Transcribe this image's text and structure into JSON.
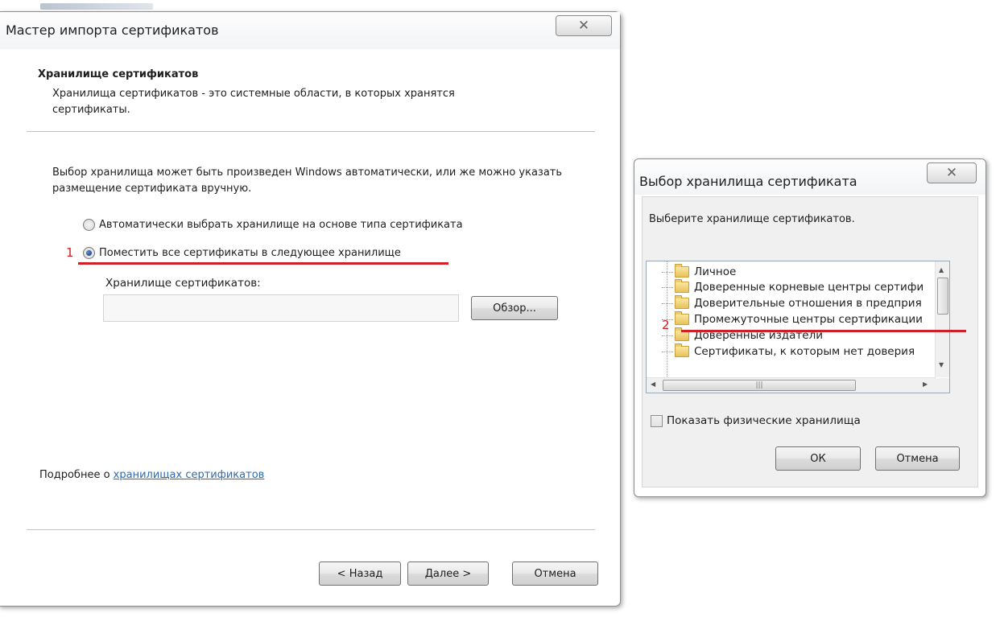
{
  "wizard": {
    "title": "Мастер импорта сертификатов",
    "section_title": "Хранилище сертификатов",
    "section_desc": "Хранилища сертификатов - это системные области, в которых хранятся сертификаты.",
    "intro": "Выбор хранилища может быть произведен Windows автоматически, или же можно указать размещение сертификата вручную.",
    "radio_auto": "Автоматически выбрать хранилище на основе типа сертификата",
    "radio_manual": "Поместить все сертификаты в следующее хранилище",
    "marker_1": "1",
    "store_label": "Хранилище сертификатов:",
    "store_value": "",
    "browse_label": "Обзор...",
    "more_prefix": "Подробнее о",
    "more_link": "хранилищах сертификатов",
    "back_label": "< Назад",
    "next_label": "Далее >",
    "cancel_label": "Отмена"
  },
  "store_dialog": {
    "title": "Выбор хранилища сертификата",
    "prompt": "Выберите хранилище сертификатов.",
    "items": [
      "Личное",
      "Доверенные корневые центры сертифи",
      "Доверительные отношения в предприя",
      "Промежуточные центры сертификации",
      "Доверенные издатели",
      "Сертификаты, к которым нет доверия"
    ],
    "marker_2": "2",
    "show_physical": "Показать физические хранилища",
    "ok_label": "ОК",
    "cancel_label": "Отмена"
  },
  "colors": {
    "annotation_red": "#cd2027",
    "link_blue": "#2c6bb3"
  }
}
